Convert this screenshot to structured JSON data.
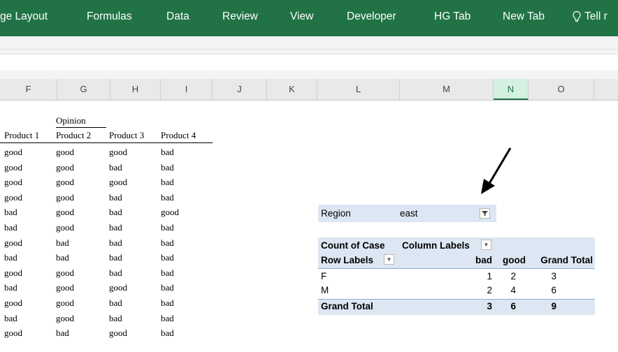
{
  "ribbon": {
    "tabs": [
      "ge Layout",
      "Formulas",
      "Data",
      "Review",
      "View",
      "Developer",
      "HG Tab",
      "New Tab"
    ],
    "tell": "Tell r"
  },
  "columns": [
    "F",
    "G",
    "H",
    "I",
    "J",
    "K",
    "L",
    "M",
    "N",
    "O"
  ],
  "table": {
    "group_header": "Opinion",
    "headers": [
      "Product 1",
      "Product 2",
      "Product 3",
      "Product 4"
    ],
    "rows": [
      [
        "good",
        "good",
        "good",
        "bad"
      ],
      [
        "good",
        "good",
        "bad",
        "bad"
      ],
      [
        "good",
        "good",
        "good",
        "bad"
      ],
      [
        "good",
        "good",
        "bad",
        "bad"
      ],
      [
        "bad",
        "good",
        "bad",
        "good"
      ],
      [
        "bad",
        "good",
        "bad",
        "bad"
      ],
      [
        "good",
        "bad",
        "bad",
        "bad"
      ],
      [
        "bad",
        "bad",
        "bad",
        "bad"
      ],
      [
        "good",
        "good",
        "bad",
        "bad"
      ],
      [
        "bad",
        "good",
        "good",
        "bad"
      ],
      [
        "good",
        "good",
        "bad",
        "bad"
      ],
      [
        "bad",
        "good",
        "bad",
        "bad"
      ],
      [
        "good",
        "bad",
        "good",
        "bad"
      ]
    ]
  },
  "pivot": {
    "filter_label": "Region",
    "filter_value": "east",
    "count_label": "Count of Case",
    "column_labels": "Column Labels",
    "row_labels": "Row Labels",
    "col_bad": "bad",
    "col_good": "good",
    "col_total": "Grand Total",
    "rows": [
      {
        "label": "F",
        "bad": "1",
        "good": "2",
        "total": "3"
      },
      {
        "label": "M",
        "bad": "2",
        "good": "4",
        "total": "6"
      }
    ],
    "grand_total_label": "Grand Total",
    "grand_total": {
      "bad": "3",
      "good": "6",
      "total": "9"
    }
  },
  "colors": {
    "ribbon": "#217346",
    "pivot_band": "#dde7f3"
  }
}
